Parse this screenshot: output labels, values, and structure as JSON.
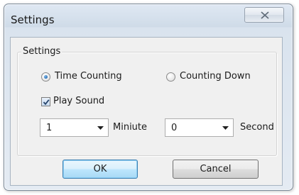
{
  "window": {
    "title": "Settings"
  },
  "group": {
    "legend": "Settings"
  },
  "mode": {
    "options": [
      "Time Counting",
      "Counting Down"
    ],
    "selected": "Time Counting"
  },
  "play_sound": {
    "label": "Play Sound",
    "checked": true
  },
  "minute": {
    "value": "1",
    "unit_label": "Miniute"
  },
  "second": {
    "value": "0",
    "unit_label": "Second"
  },
  "buttons": {
    "ok_label": "OK",
    "cancel_label": "Cancel"
  },
  "colors": {
    "radio_accent": "#2a6fb8",
    "default_button_border": "#3c7fb1"
  }
}
